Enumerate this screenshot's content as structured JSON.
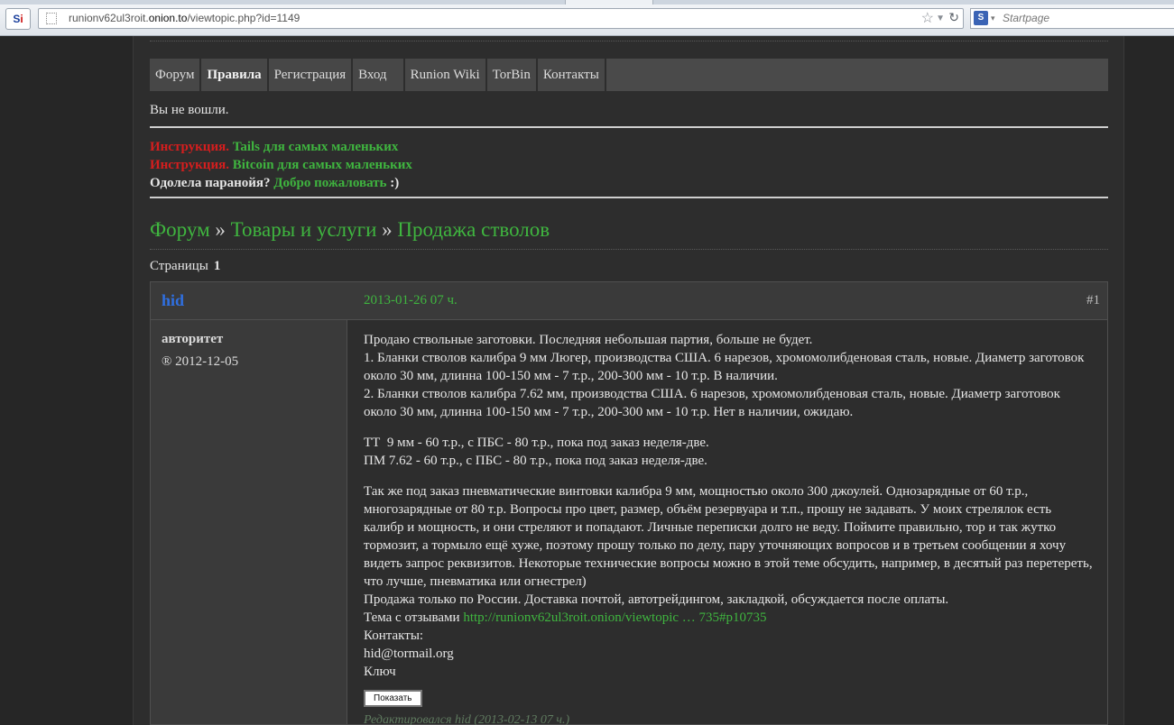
{
  "browser": {
    "site_badge": "S",
    "site_badge_accent": "i",
    "url_host_prefix": "runionv62ul3roit.",
    "url_host_bold": "onion.to",
    "url_path": "/viewtopic.php?id=1149",
    "search_placeholder": "Startpage"
  },
  "nav": [
    "Форум",
    "Правила",
    "Регистрация",
    "Вход",
    "Runion Wiki",
    "TorBin",
    "Контакты"
  ],
  "status": "Вы не вошли.",
  "announcements": {
    "line1_label": "Инструкция.",
    "line1_link": "Tails для самых маленьких",
    "line2_label": "Инструкция.",
    "line2_link": "Bitcoin для самых маленьких",
    "line3_text": "Одолела паранойя?",
    "line3_link": "Добро пожаловать",
    "line3_suffix": ":)"
  },
  "breadcrumb": {
    "c1": "Форум",
    "sep": "»",
    "c2": "Товары и услуги",
    "c3": "Продажа стволов"
  },
  "pages": {
    "label": "Страницы",
    "current": "1"
  },
  "post": {
    "author": "hid",
    "date": "2013-01-26 07 ч.",
    "number": "#1",
    "rank": "авторитет",
    "registered": "® 2012-12-05",
    "p1": [
      "Продаю ствольные заготовки. Последняя небольшая партия, больше не будет.",
      "1. Бланки стволов калибра 9 мм Люгер, производства США. 6 нарезов, хромомолибденовая сталь, новые. Диаметр заготовок около 30 мм, длинна 100-150 мм - 7 т.р., 200-300 мм - 10 т.р. В наличии.",
      "2. Бланки стволов калибра 7.62 мм, производства США. 6 нарезов, хромомолибденовая сталь, новые. Диаметр заготовок около 30 мм, длинна 100-150 мм - 7 т.р., 200-300 мм - 10 т.р. Нет в наличии, ожидаю."
    ],
    "p2": [
      "ТТ  9 мм - 60 т.р., с ПБС - 80 т.р., пока под заказ неделя-две.",
      "ПМ 7.62 - 60 т.р., с ПБС - 80 т.р., пока под заказ неделя-две."
    ],
    "p3_main": "Так же под заказ пневматические винтовки калибра 9 мм, мощностью около 300 джоулей. Однозарядные от 60 т.р., многозарядные от 80 т.р. Вопросы про цвет, размер, объём резервуара и т.п., прошу не задавать. У моих стрелялок есть калибр и мощность, и они стреляют и попадают. Личные переписки долго не веду. Поймите правильно, тор и так жутко тормозит, а тормыло ещё хуже, поэтому прошу только по делу, пару уточняющих вопросов и в третьем сообщении я хочу видеть запрос реквизитов. Некоторые технические вопросы можно в этой теме обсудить, например, в десятый раз перетереть, что лучше, пневматика или огнестрел)",
    "p3_delivery": "Продажа только по России. Доставка почтой, автотрейдингом, закладкой, обсуждается после оплаты.",
    "p3_reviews_label": "Тема с отзывами",
    "p3_reviews_link": "http://runionv62ul3roit.onion/viewtopic … 735#p10735",
    "p3_contacts": "Контакты:",
    "p3_email": "hid@tormail.org",
    "p3_key": "Ключ",
    "show_button": "Показать",
    "edited": "Редактировался hid (2013-02-13 07 ч.)"
  }
}
